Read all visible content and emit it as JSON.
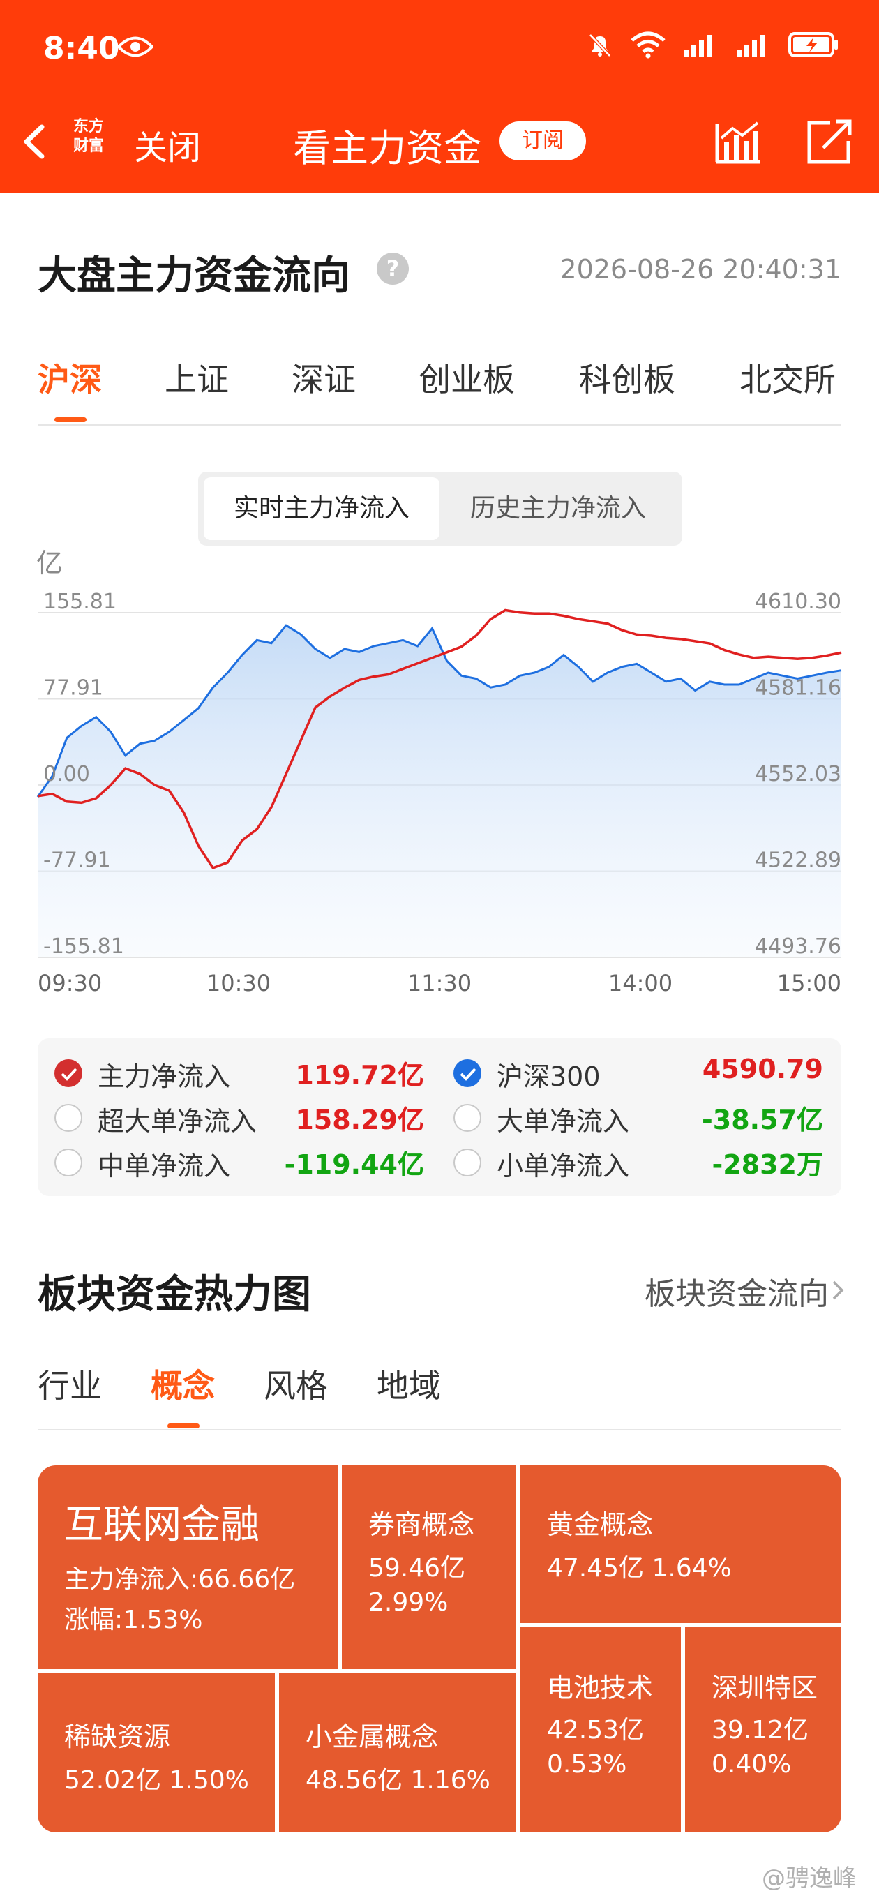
{
  "status": {
    "time": "8:40"
  },
  "header": {
    "logo_line1": "东方",
    "logo_line2": "财富",
    "close": "关闭",
    "title": "看主力资金",
    "subscribe": "订阅"
  },
  "flow": {
    "title": "大盘主力资金流向",
    "timestamp": "2026-08-26 20:40:31",
    "tabs": [
      "沪深",
      "上证",
      "深证",
      "创业板",
      "科创板",
      "北交所"
    ],
    "active_tab": "沪深",
    "segments": [
      "实时主力净流入",
      "历史主力净流入"
    ],
    "active_segment": "实时主力净流入"
  },
  "chart_data": {
    "type": "line",
    "unit_label": "亿",
    "x_ticks": [
      "09:30",
      "10:30",
      "11:30",
      "14:00",
      "15:00"
    ],
    "y_left_ticks": [
      "155.81",
      "77.91",
      "0.00",
      "-77.91",
      "-155.81"
    ],
    "y_right_ticks": [
      "4610.30",
      "4581.16",
      "4552.03",
      "4522.89",
      "4493.76"
    ],
    "ylim_left": [
      -155.81,
      155.81
    ],
    "ylim_right": [
      4493.76,
      4610.3
    ],
    "series": [
      {
        "name": "主力净流入",
        "color": "#e02020",
        "axis": "left",
        "values": [
          -10,
          -8,
          -15,
          -16,
          -12,
          0,
          15,
          10,
          0,
          -5,
          -25,
          -55,
          -75,
          -70,
          -50,
          -40,
          -20,
          10,
          40,
          70,
          80,
          88,
          95,
          98,
          100,
          105,
          110,
          115,
          120,
          125,
          135,
          150,
          158,
          156,
          155,
          155,
          153,
          150,
          148,
          146,
          140,
          136,
          135,
          133,
          132,
          130,
          128,
          122,
          118,
          115,
          116,
          115,
          114,
          115,
          117,
          119.72
        ]
      },
      {
        "name": "沪深300",
        "color": "#1e6fe0",
        "axis": "right",
        "values": [
          4548,
          4555,
          4568,
          4572,
          4575,
          4570,
          4562,
          4566,
          4567,
          4570,
          4574,
          4578,
          4585,
          4590,
          4596,
          4601,
          4600,
          4606,
          4603,
          4598,
          4595,
          4598,
          4597,
          4599,
          4600,
          4601,
          4599,
          4605,
          4594,
          4589,
          4588,
          4585,
          4586,
          4589,
          4590,
          4592,
          4596,
          4592,
          4587,
          4590,
          4592,
          4593,
          4590,
          4587,
          4588,
          4584,
          4587,
          4586,
          4586,
          4588,
          4590,
          4589,
          4588,
          4589,
          4590,
          4590.79
        ]
      }
    ],
    "grid": true,
    "legend": [
      {
        "label": "主力净流入",
        "value": "119.72亿",
        "checked": true,
        "check_color": "red",
        "value_color": "red"
      },
      {
        "label": "沪深300",
        "value": "4590.79",
        "checked": true,
        "check_color": "blue",
        "value_color": "red"
      },
      {
        "label": "超大单净流入",
        "value": "158.29亿",
        "checked": false,
        "value_color": "red"
      },
      {
        "label": "大单净流入",
        "value": "-38.57亿",
        "checked": false,
        "value_color": "green"
      },
      {
        "label": "中单净流入",
        "value": "-119.44亿",
        "checked": false,
        "value_color": "green"
      },
      {
        "label": "小单净流入",
        "value": "-2832万",
        "checked": false,
        "value_color": "green"
      }
    ]
  },
  "heatmap": {
    "title": "板块资金热力图",
    "more": "板块资金流向",
    "tabs": [
      "行业",
      "概念",
      "风格",
      "地域"
    ],
    "active_tab": "概念",
    "cells": [
      {
        "name": "互联网金融",
        "line1": "主力净流入:66.66亿",
        "line2": "涨幅:1.53%"
      },
      {
        "name": "券商概念",
        "line1": "59.46亿",
        "line2": "2.99%"
      },
      {
        "name": "黄金概念",
        "line1": "47.45亿  1.64%",
        "line2": ""
      },
      {
        "name": "稀缺资源",
        "line1": "52.02亿  1.50%",
        "line2": ""
      },
      {
        "name": "小金属概念",
        "line1": "48.56亿  1.16%",
        "line2": ""
      },
      {
        "name": "电池技术",
        "line1": "42.53亿",
        "line2": "0.53%"
      },
      {
        "name": "深圳特区",
        "line1": "39.12亿",
        "line2": "0.40%"
      }
    ]
  },
  "watermark": "@骋逸峰",
  "colors": {
    "brand": "#ff3c0a",
    "accent": "#ff5a16",
    "up": "#e02020",
    "down": "#12a512",
    "tile": "#e55a2e"
  }
}
